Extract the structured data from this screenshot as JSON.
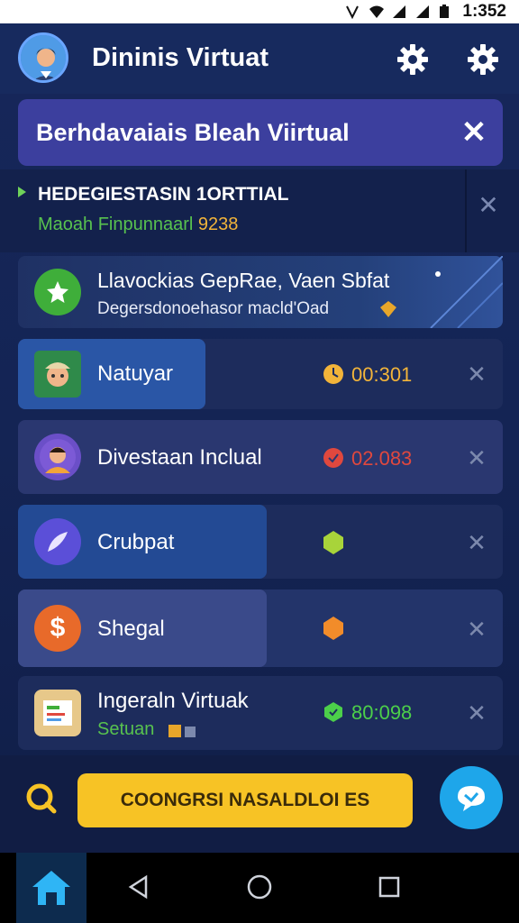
{
  "status_bar": {
    "time": "1:352"
  },
  "header": {
    "title": "Dininis Virtuat",
    "icons": [
      "gear-icon",
      "settings-icon"
    ]
  },
  "banner": {
    "text": "Berhdavaiais Bleah Viirtual"
  },
  "section": {
    "title": "HEDEGIESTASIN 1ORTTIAL",
    "subtitle_prefix": "Maoah Finpunnaarl",
    "subtitle_number": "9238"
  },
  "featured": {
    "title": "Llavockias GepRae, Vaen Sbfat",
    "subtitle": "Degersdonoehasor macld'Oad"
  },
  "items": [
    {
      "name": "Natuyar",
      "value": "00:301",
      "value_color": "#f2b43a"
    },
    {
      "name": "Divestaan Inclual",
      "value": "02.083",
      "value_color": "#e0483e"
    },
    {
      "name": "Crubpat",
      "value": "",
      "value_color": "#a8d43a"
    },
    {
      "name": "Shegal",
      "value": "",
      "value_color": "#f28c2a"
    },
    {
      "name": "Ingeraln Virtuak",
      "sub": "Setuan",
      "value": "80:098",
      "value_color": "#4ccf4a"
    }
  ],
  "cta": {
    "label": "COONGRSI NASALDLOI ES"
  },
  "colors": {
    "accent": "#f7c325",
    "fab": "#1ea6ea",
    "background": "#0f1c44"
  }
}
